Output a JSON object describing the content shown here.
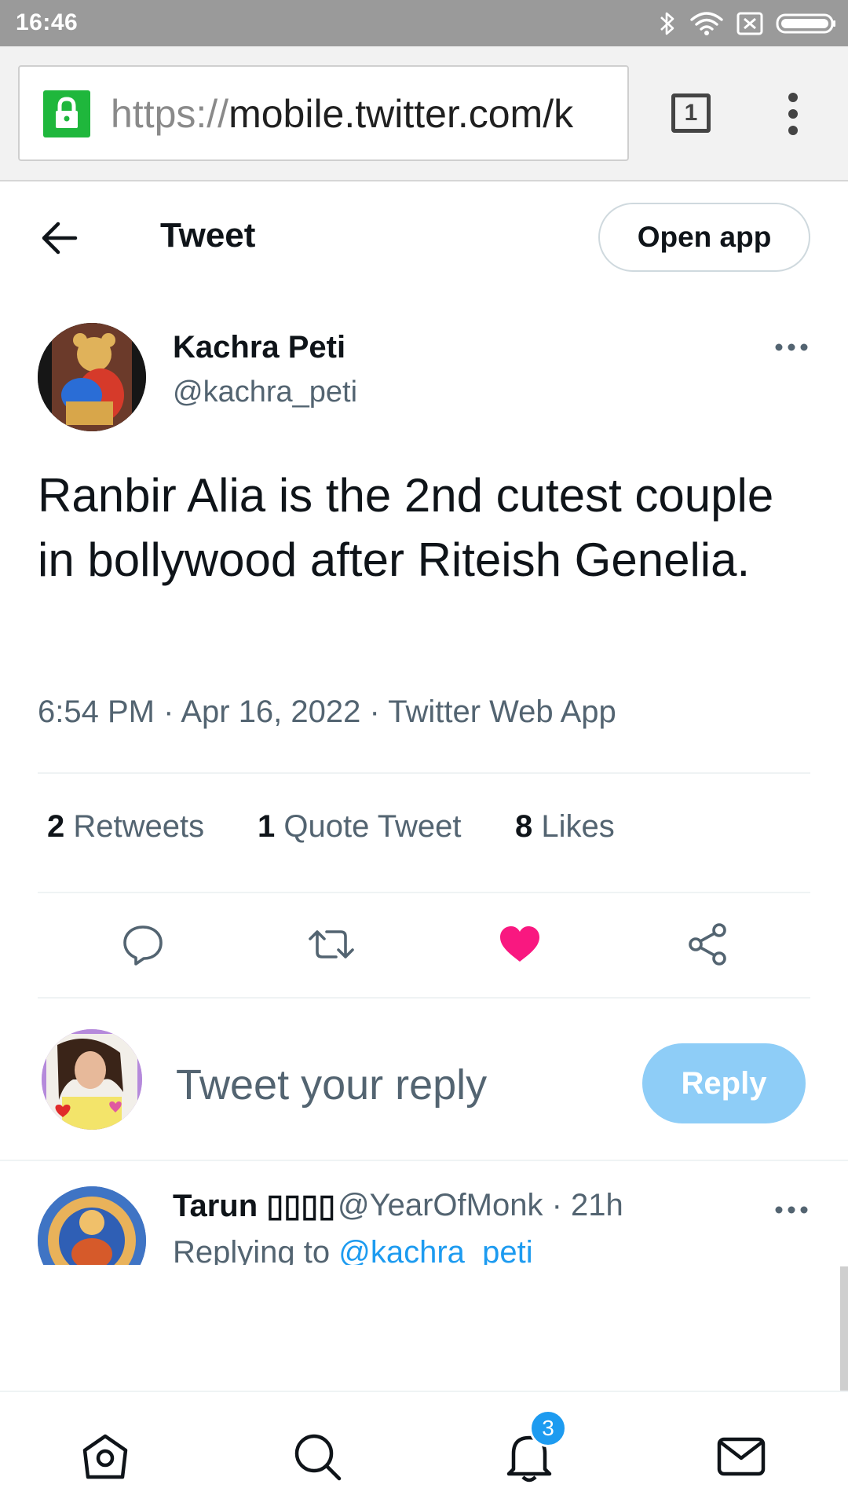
{
  "status_bar": {
    "time": "16:46"
  },
  "browser": {
    "url_scheme": "https://",
    "url_host": "mobile.twitter.com/k",
    "tab_count": "1"
  },
  "header": {
    "title": "Tweet",
    "open_app_label": "Open app"
  },
  "tweet": {
    "display_name": "Kachra Peti",
    "handle": "@kachra_peti",
    "text": "Ranbir Alia is the 2nd cutest couple in bollywood after Riteish Genelia.",
    "time": "6:54 PM",
    "date": "Apr 16, 2022",
    "source": "Twitter Web App",
    "separator": "·",
    "stats": {
      "retweets_count": "2",
      "retweets_label": "Retweets",
      "quotes_count": "1",
      "quotes_label": "Quote Tweet",
      "likes_count": "8",
      "likes_label": "Likes"
    },
    "liked": true,
    "like_color": "#f91880"
  },
  "composer": {
    "placeholder": "Tweet your reply",
    "reply_label": "Reply"
  },
  "reply_preview": {
    "display_name": "Tarun ▯▯▯▯",
    "handle_time": "@YearOfMonk · 21h",
    "replying_prefix": "Replying to ",
    "replying_handle": "@kachra_peti"
  },
  "bottom_nav": {
    "notifications_badge": "3"
  },
  "colors": {
    "accent": "#1d9bf0",
    "reply_button": "#8ecdf7",
    "secure_lock": "#1fb73c"
  }
}
